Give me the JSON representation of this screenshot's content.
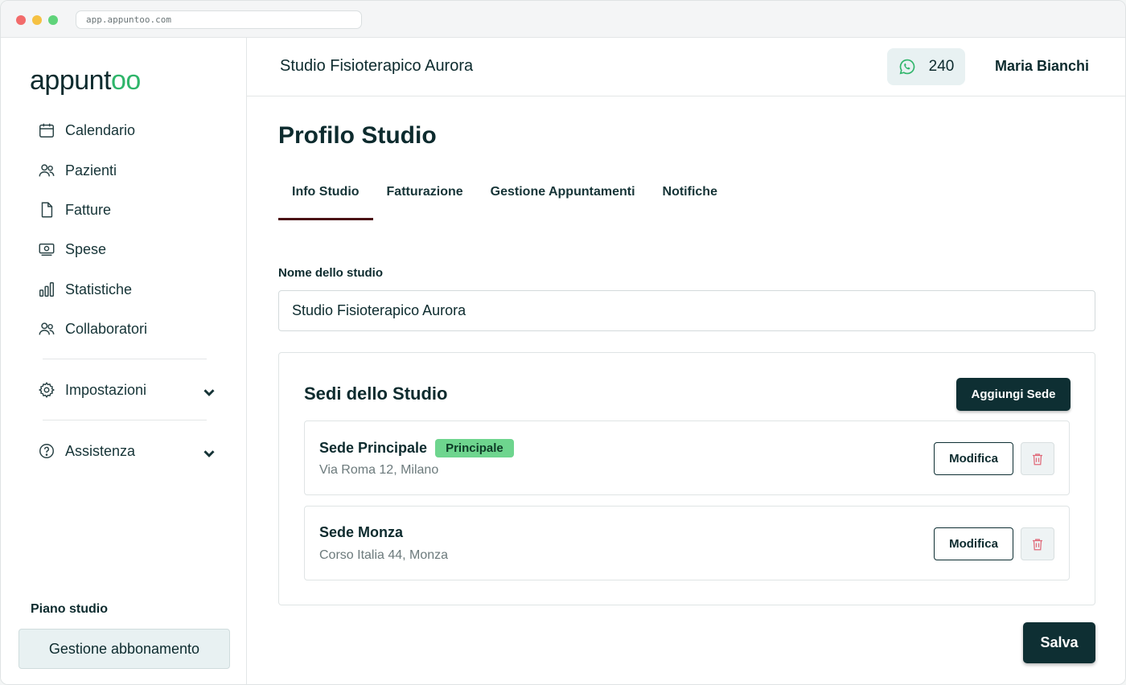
{
  "browser": {
    "url": "app.appuntoo.com"
  },
  "brand": {
    "logo_prefix": "appunt",
    "logo_suffix": "oo",
    "accent": "#2fb56a",
    "dark": "#0e2f33"
  },
  "sidebar": {
    "items": [
      {
        "label": "Calendario",
        "icon": "calendar-icon"
      },
      {
        "label": "Pazienti",
        "icon": "users-icon"
      },
      {
        "label": "Fatture",
        "icon": "file-icon"
      },
      {
        "label": "Spese",
        "icon": "money-icon"
      },
      {
        "label": "Statistiche",
        "icon": "bar-chart-icon"
      },
      {
        "label": "Collaboratori",
        "icon": "users-icon"
      }
    ],
    "settings": {
      "label": "Impostazioni",
      "icon": "gear-icon"
    },
    "help": {
      "label": "Assistenza",
      "icon": "help-icon"
    },
    "plan_label": "Piano studio",
    "plan_button": "Gestione abbonamento"
  },
  "header": {
    "studio_name": "Studio Fisioterapico Aurora",
    "whatsapp_count": "240",
    "user_name": "Maria Bianchi"
  },
  "main": {
    "title": "Profilo Studio",
    "tabs": [
      {
        "label": "Info Studio",
        "active": true
      },
      {
        "label": "Fatturazione",
        "active": false
      },
      {
        "label": "Gestione Appuntamenti",
        "active": false
      },
      {
        "label": "Notifiche",
        "active": false
      }
    ],
    "name_field": {
      "label": "Nome dello studio",
      "value": "Studio Fisioterapico Aurora"
    },
    "locations": {
      "title": "Sedi dello Studio",
      "add_label": "Aggiungi Sede",
      "items": [
        {
          "name": "Sede Principale",
          "badge": "Principale",
          "address": "Via Roma 12, Milano",
          "edit_label": "Modifica"
        },
        {
          "name": "Sede Monza",
          "badge": "",
          "address": "Corso Italia 44, Monza",
          "edit_label": "Modifica"
        }
      ]
    },
    "save_label": "Salva"
  }
}
